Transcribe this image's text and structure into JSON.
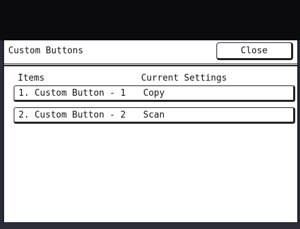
{
  "header": {
    "title": "Custom Buttons",
    "close_label": "Close"
  },
  "columns": {
    "items": "Items",
    "current_settings": "Current Settings"
  },
  "rows": [
    {
      "name": "1. Custom Button - 1",
      "setting": "Copy"
    },
    {
      "name": "2. Custom Button - 2",
      "setting": "Scan"
    }
  ]
}
